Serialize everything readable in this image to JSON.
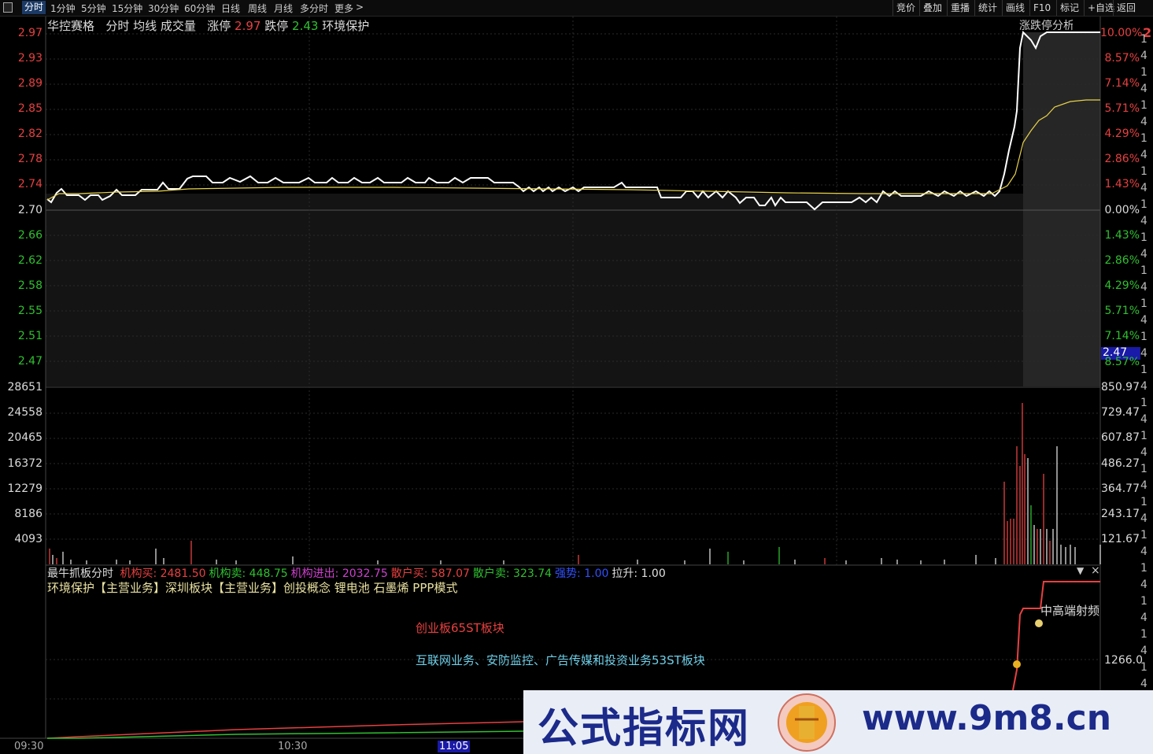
{
  "toolbar": {
    "icon": "square-icon",
    "tabs": [
      "分时",
      "1分钟",
      "5分钟",
      "15分钟",
      "30分钟",
      "60分钟",
      "日线",
      "周线",
      "月线",
      "多分时",
      "更多"
    ],
    "more_arrow": ">",
    "right_buttons": [
      "竞价",
      "叠加",
      "重播",
      "统计",
      "画线",
      "F10",
      "标记",
      "+自选",
      "返回"
    ]
  },
  "header": {
    "stock_name": "华控赛格",
    "items": [
      "分时",
      "均线",
      "成交量"
    ],
    "limit_up_label": "涨停",
    "limit_up_value": "2.97",
    "limit_down_label": "跌停",
    "limit_down_value": "2.43",
    "concept": "环境保护",
    "right_label": "涨跌停分析",
    "right_cut": "2"
  },
  "price_axis": {
    "left": [
      "2.97",
      "2.93",
      "2.89",
      "2.85",
      "2.82",
      "2.78",
      "2.74",
      "2.70",
      "2.66",
      "2.62",
      "2.58",
      "2.55",
      "2.51",
      "2.47"
    ],
    "right": [
      "10.00%",
      "8.57%",
      "7.14%",
      "5.71%",
      "4.29%",
      "2.86%",
      "1.43%",
      "0.00%",
      "1.43%",
      "2.86%",
      "4.29%",
      "5.71%",
      "7.14%",
      "8.57%"
    ],
    "current_price_tag": "2.47"
  },
  "volume_axis": {
    "left": [
      "28651",
      "24558",
      "20465",
      "16372",
      "12279",
      "8186",
      "4093"
    ],
    "right": [
      "850.97",
      "729.47",
      "607.87",
      "486.27",
      "364.77",
      "243.17",
      "121.67"
    ]
  },
  "indicator": {
    "title": "最牛抓板分时",
    "items": [
      {
        "label": "机构买:",
        "value": "2481.50",
        "color": "#e84040"
      },
      {
        "label": "机构卖:",
        "value": "448.75",
        "color": "#30c030"
      },
      {
        "label": "机构进出:",
        "value": "2032.75",
        "color": "#d040d0"
      },
      {
        "label": "散户买:",
        "value": "587.07",
        "color": "#e84040"
      },
      {
        "label": "散户卖:",
        "value": "323.74",
        "color": "#30c030"
      },
      {
        "label": "强势:",
        "value": "1.00",
        "color": "#3050ff"
      },
      {
        "label": "拉升:",
        "value": "1.00",
        "color": "#e0e0e0"
      }
    ],
    "sectors": "环境保护【主营业务】深圳板块【主营业务】创投概念 锂电池 石墨烯 PPP模式",
    "note1": "创业板65ST板块",
    "note2": "互联网业务、安防监控、广告传媒和投资业务53ST板块",
    "signal_label": "中高端射频",
    "right_value": "1266.0",
    "dropdown": "▼",
    "close": "×"
  },
  "time_axis": [
    "09:30",
    "10:30",
    "11:05"
  ],
  "side_strip": [
    "1",
    "4"
  ],
  "watermark": {
    "text": "公式指标网",
    "url": "www.9m8.cn"
  },
  "colors": {
    "price_line": "#ffffff",
    "avg_line": "#e8d24a",
    "up": "#e84040",
    "down": "#30c030",
    "grid": "#3a1010"
  }
}
